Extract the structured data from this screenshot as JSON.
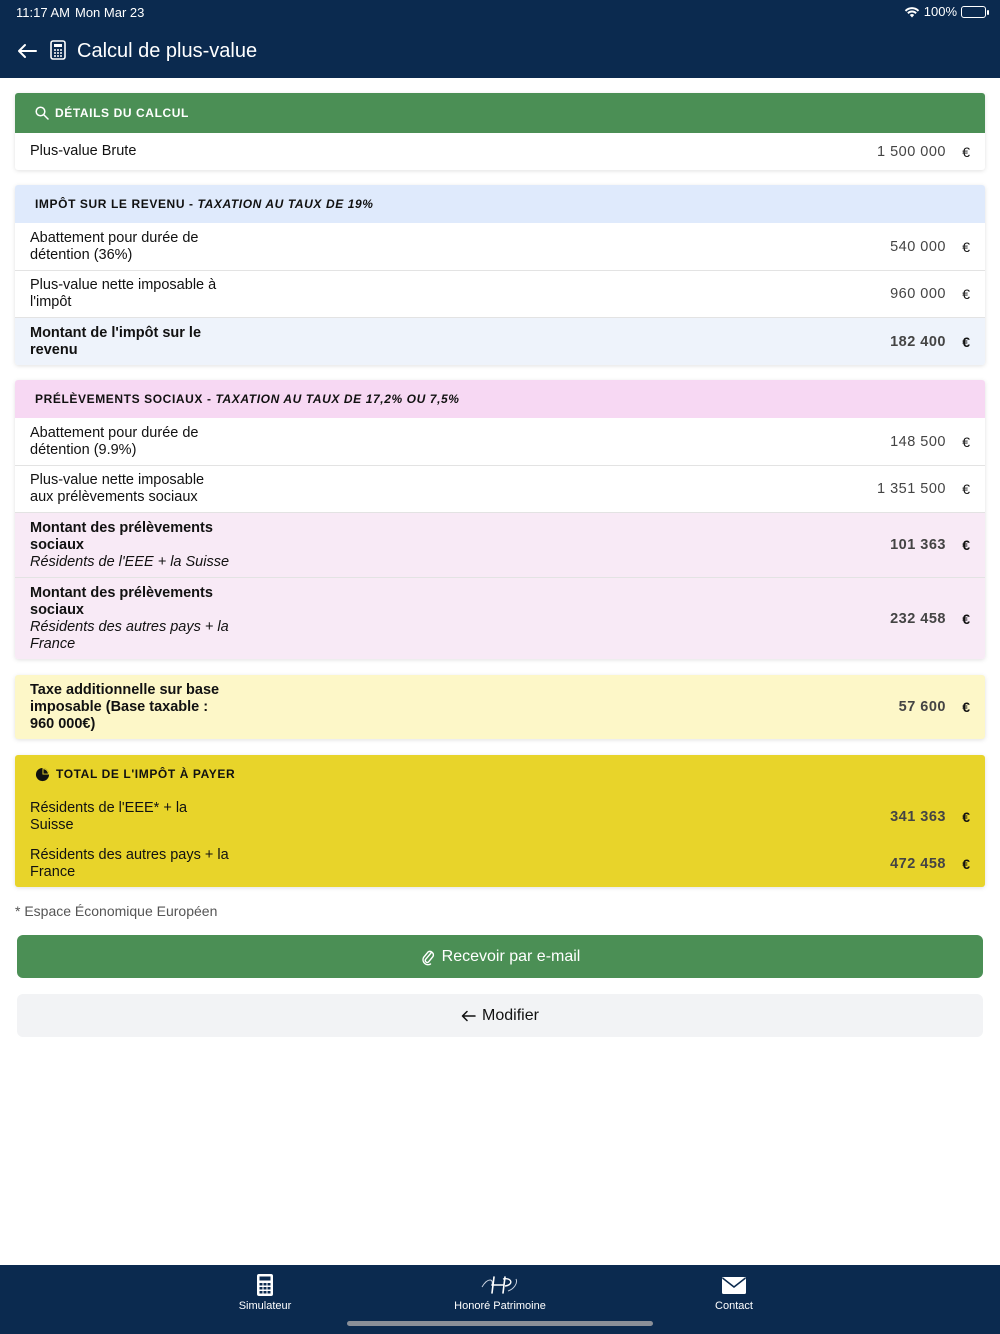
{
  "status_bar": {
    "time": "11:17 AM",
    "date": "Mon Mar 23",
    "battery": "100%"
  },
  "nav": {
    "title": "Calcul de plus-value",
    "back_icon": "arrow-left-icon",
    "title_icon": "calculator-icon"
  },
  "details": {
    "header": "DÉTAILS DU CALCUL",
    "header_icon": "search-icon",
    "header_color": "#4b8f55",
    "rows": [
      {
        "label": "Plus-value Brute",
        "value": "1 500 000",
        "currency": "€"
      }
    ]
  },
  "impot_revenu": {
    "header": "IMPÔT SUR LE REVENU - ",
    "header_em": "TAXATION AU TAUX DE 19%",
    "header_color": "#dfeafc",
    "rows": [
      {
        "label": "Abattement pour durée de détention (36%)",
        "value": "540 000",
        "currency": "€"
      },
      {
        "label": "Plus-value nette imposable à l'impôt",
        "value": "960 000",
        "currency": "€"
      }
    ],
    "total": {
      "label": "Montant de l'impôt sur le revenu",
      "value": "182 400",
      "currency": "€"
    }
  },
  "prelevements": {
    "header": "PRÉLÈVEMENTS SOCIAUX - ",
    "header_em": "TAXATION AU TAUX DE 17,2% OU 7,5%",
    "header_color": "#f7d8f3",
    "rows": [
      {
        "label": "Abattement pour durée de détention (9.9%)",
        "value": "148 500",
        "currency": "€"
      },
      {
        "label": "Plus-value nette imposable aux prélèvements sociaux",
        "value": "1 351 500",
        "currency": "€"
      }
    ],
    "totals": [
      {
        "label": "Montant des prélèvements sociaux",
        "sub": "Résidents de l'EEE + la Suisse",
        "value": "101 363",
        "currency": "€"
      },
      {
        "label": "Montant des prélèvements sociaux",
        "sub": "Résidents des autres pays + la France",
        "value": "232 458",
        "currency": "€"
      }
    ]
  },
  "taxe_additionnelle": {
    "label": "Taxe additionnelle sur base imposable (Base taxable : 960 000€)",
    "value": "57 600",
    "currency": "€",
    "color": "#fdf7c8"
  },
  "total_impot": {
    "header": "TOTAL DE L'IMPÔT À PAYER",
    "header_icon": "pie-chart-icon",
    "color": "#e8d42a",
    "rows": [
      {
        "label": "Résidents de l'EEE* + la Suisse",
        "value": "341 363",
        "currency": "€"
      },
      {
        "label": "Résidents des autres pays + la France",
        "value": "472 458",
        "currency": "€"
      }
    ]
  },
  "footnote": "* Espace Économique Européen",
  "buttons": {
    "email": {
      "label": "Recevoir par e-mail",
      "icon": "paperclip-icon"
    },
    "modify": {
      "label": "Modifier",
      "icon": "arrow-left-icon"
    }
  },
  "tabs": [
    {
      "label": "Simulateur",
      "icon": "calculator-icon"
    },
    {
      "label": "Honoré Patrimoine",
      "icon": "hp-logo-icon"
    },
    {
      "label": "Contact",
      "icon": "envelope-icon"
    }
  ]
}
